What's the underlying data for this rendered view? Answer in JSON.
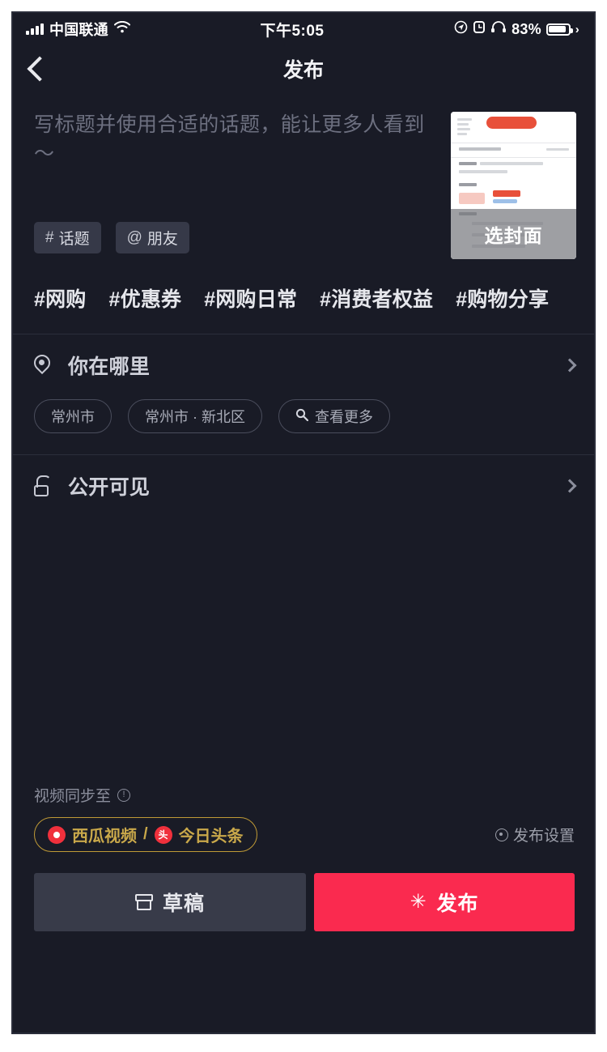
{
  "status_bar": {
    "carrier": "中国联通",
    "signal_icon": "signal-bars-icon",
    "wifi_icon": "wifi-icon",
    "time": "下午5:05",
    "location_icon": "location-services-icon",
    "alarm_icon": "alarm-clock-icon",
    "headphone_icon": "headphones-icon",
    "battery_percent": "83%",
    "battery_icon": "battery-icon"
  },
  "nav": {
    "back_icon": "back-chevron-icon",
    "title": "发布"
  },
  "composer": {
    "placeholder": "写标题并使用合适的话题，能让更多人看到～",
    "value": "",
    "chips": [
      {
        "glyph": "#",
        "label": "话题",
        "icon": "hash-icon"
      },
      {
        "glyph": "@",
        "label": "朋友",
        "icon": "at-mention-icon"
      }
    ],
    "thumbnail": {
      "cover_label": "选封面",
      "icon": "video-thumbnail"
    }
  },
  "hashtag_suggestions": [
    "#网购",
    "#优惠券",
    "#网购日常",
    "#消费者权益",
    "#购物分享"
  ],
  "location": {
    "icon": "map-pin-icon",
    "label": "你在哪里",
    "chevron_icon": "chevron-right-icon",
    "pills": [
      {
        "label": "常州市",
        "icon": null
      },
      {
        "label": "常州市 · 新北区",
        "icon": null
      },
      {
        "label": "查看更多",
        "icon": "search-icon"
      }
    ]
  },
  "privacy": {
    "icon": "unlock-icon",
    "label": "公开可见",
    "chevron_icon": "chevron-right-icon"
  },
  "sync": {
    "label": "视频同步至",
    "info_icon": "info-circle-icon",
    "info_glyph": "!",
    "targets": [
      {
        "name": "西瓜视频",
        "icon": "xigua-video-icon"
      },
      {
        "name": "今日头条",
        "icon": "toutiao-icon"
      }
    ],
    "separator": "/",
    "toutiao_glyph": "头",
    "settings": {
      "label": "发布设置",
      "icon": "gear-icon"
    }
  },
  "actions": {
    "draft": {
      "label": "草稿",
      "icon": "archive-box-icon"
    },
    "publish": {
      "label": "发布",
      "icon": "sparkle-icon",
      "glyph": "✳"
    }
  },
  "colors": {
    "page_background": "#191b26",
    "publish_accent": "#fa2a4f",
    "draft_background": "#383b49",
    "sync_gold": "#c9a84a",
    "chip_background": "#363948",
    "placeholder_text": "#6d7080"
  }
}
